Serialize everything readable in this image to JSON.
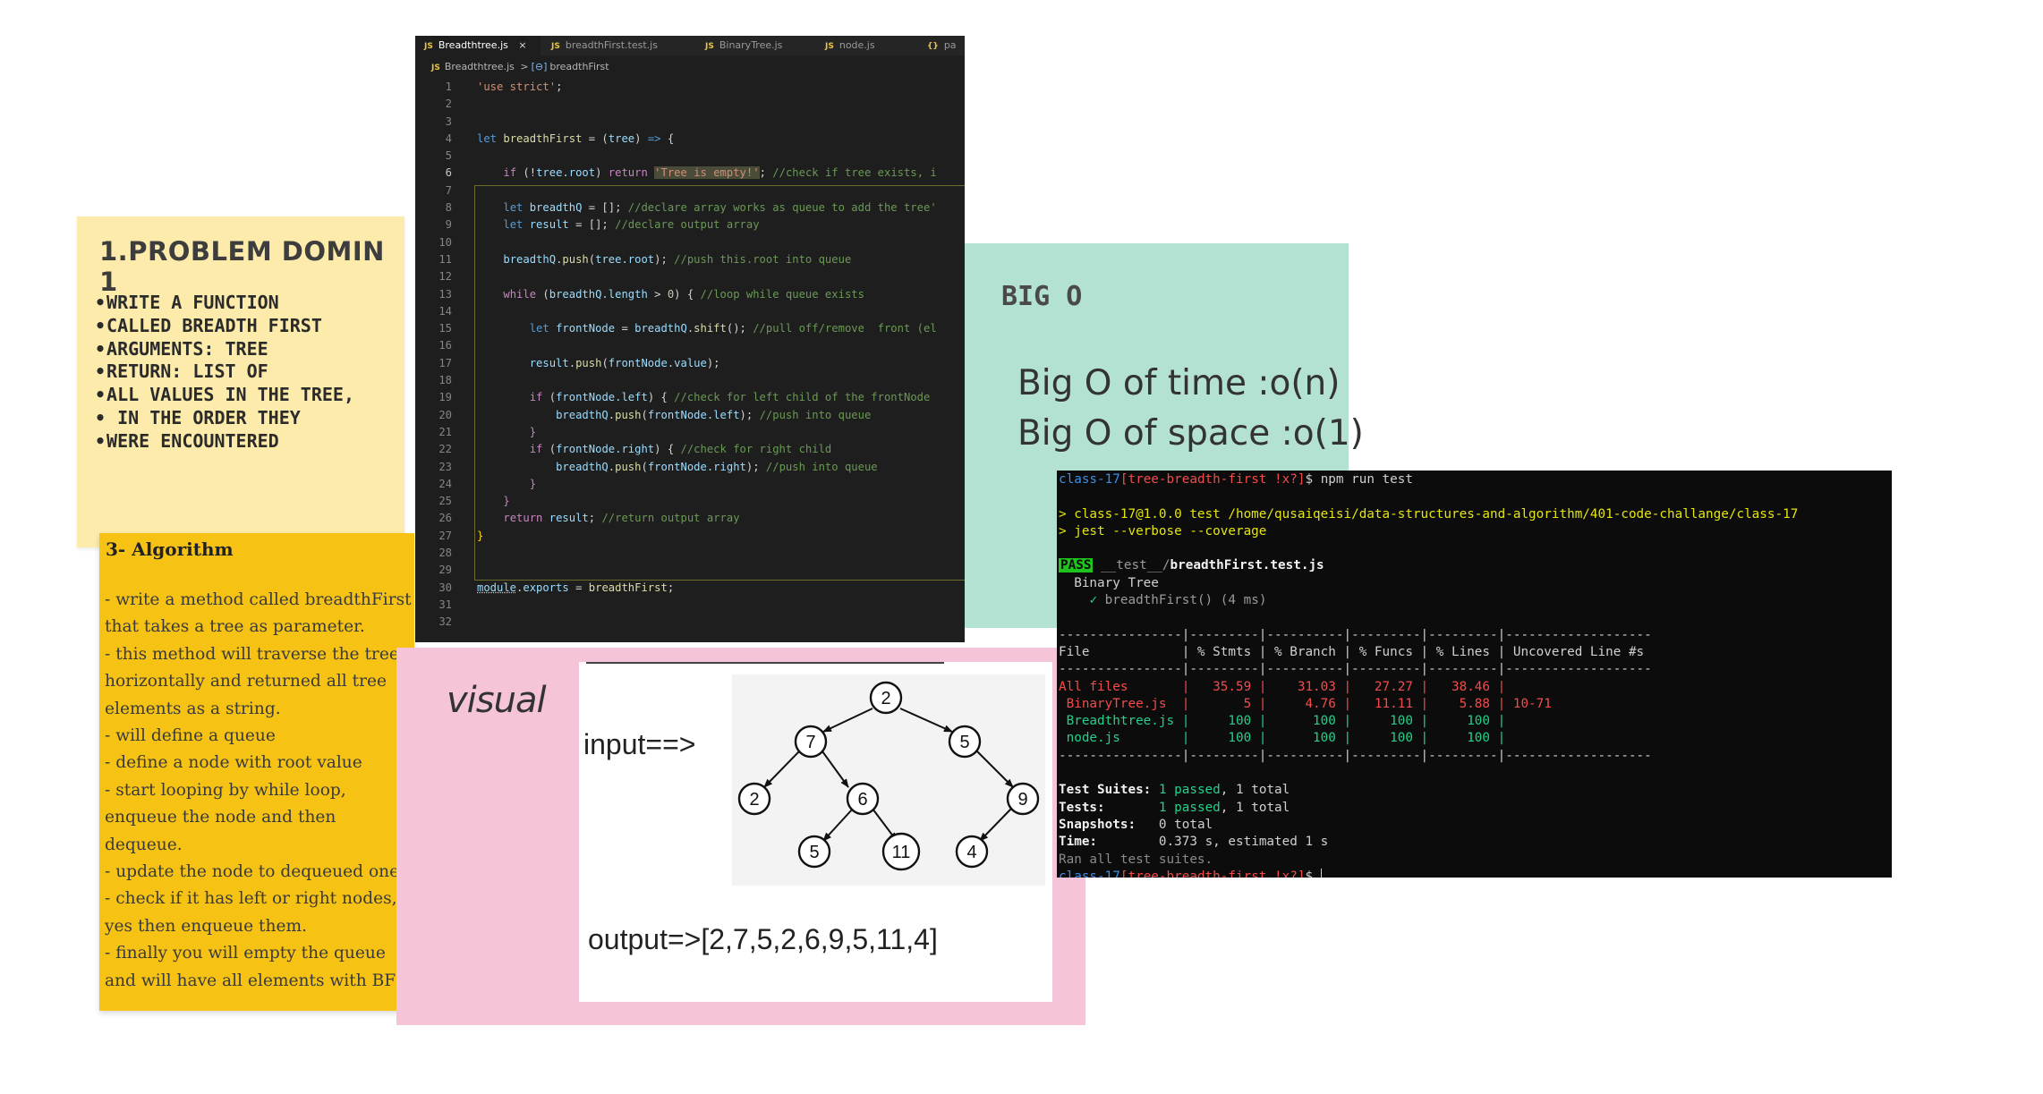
{
  "problem_note": {
    "title": "1.PROBLEM DOMIN 1",
    "bullets": [
      "WRITE A FUNCTION",
      "CALLED BREADTH FIRST",
      "ARGUMENTS: TREE",
      "RETURN: LIST OF",
      "ALL VALUES IN THE TREE,",
      " IN THE ORDER THEY",
      "WERE ENCOUNTERED"
    ]
  },
  "algorithm_note": {
    "title": "3- Algorithm",
    "lines": [
      "- write a method called breadthFirst",
      "that takes a tree as parameter.",
      "- this method will traverse the tree",
      "horizontally and returned all tree",
      "elements as a string.",
      "- will define a queue",
      "- define a node with root value",
      "- start looping by while loop,",
      "enqueue the node and then",
      "dequeue.",
      "- update the node to dequeued one.",
      "- check if it has left or right nodes, if",
      "yes then enqueue them.",
      "- finally you will empty the queue",
      "and will have all elements with BFS."
    ]
  },
  "big_o_note": {
    "title": "BIG O",
    "time": "Big O of time :o(n)",
    "space": "Big O of space :o(1)"
  },
  "visual_note": {
    "title": "visual",
    "input_label": "input==>",
    "output_label": "output=>[2,7,5,2,6,9,5,11,4]",
    "tree_nodes": {
      "root": "2",
      "l": "7",
      "r": "5",
      "ll": "2",
      "lr": "6",
      "rr": "9",
      "lrl": "5",
      "lrr": "11",
      "rrl": "4"
    }
  },
  "editor": {
    "tabs": [
      {
        "label": "Breadthtree.js",
        "icon": "JS",
        "close": "×"
      },
      {
        "label": "breadthFirst.test.js",
        "icon": "JS"
      },
      {
        "label": "BinaryTree.js",
        "icon": "JS"
      },
      {
        "label": "node.js",
        "icon": "JS"
      },
      {
        "label": "pa",
        "icon": "{}"
      }
    ],
    "breadcrumb": {
      "icon": "JS",
      "file": "Breadthtree.js",
      "separator": ">",
      "symbol_icon": "[⊖]",
      "symbol": "breadthFirst"
    },
    "line_numbers": [
      "1",
      "2",
      "3",
      "4",
      "5",
      "6",
      "7",
      "8",
      "9",
      "10",
      "11",
      "12",
      "13",
      "14",
      "15",
      "16",
      "17",
      "18",
      "19",
      "20",
      "21",
      "22",
      "23",
      "24",
      "25",
      "26",
      "27",
      "28",
      "29",
      "30",
      "31",
      "32"
    ],
    "code": {
      "l1_str": "'use strict'",
      "l1_pu": ";",
      "l4_kw": "let",
      "l4_fn": "breadthFirst",
      "l4_pu1": " = (",
      "l4_vr": "tree",
      "l4_pu2": ") ",
      "l4_kw2": "=>",
      "l4_pu3": " {",
      "l6_ctl": "if",
      "l6_pu1": " (!",
      "l6_vr": "tree.root",
      "l6_pu2": ") ",
      "l6_ctl2": "return",
      "l6_str": "'Tree is empty!'",
      "l6_pu3": "; ",
      "l6_cm": "//check if tree exists, i",
      "l8_kw": "let",
      "l8_vr": "breadthQ",
      "l8_pu": " = []; ",
      "l8_cm": "//declare array works as queue to add the tree'",
      "l9_kw": "let",
      "l9_vr": "result",
      "l9_pu": " = []; ",
      "l9_cm": "//declare output array",
      "l11_vr": "breadthQ",
      "l11_pu1": ".",
      "l11_fn": "push",
      "l11_pu2": "(",
      "l11_vr2": "tree.root",
      "l11_pu3": "); ",
      "l11_cm": "//push this.root into queue",
      "l13_ctl": "while",
      "l13_pu1": " (",
      "l13_vr": "breadthQ.length",
      "l13_pu2": " > ",
      "l13_num": "0",
      "l13_pu3": ") { ",
      "l13_cm": "//loop while queue exists",
      "l15_kw": "let",
      "l15_vr": "frontNode",
      "l15_pu1": " = ",
      "l15_vr2": "breadthQ",
      "l15_pu2": ".",
      "l15_fn": "shift",
      "l15_pu3": "(); ",
      "l15_cm": "//pull off/remove  front (el",
      "l17_vr": "result",
      "l17_pu1": ".",
      "l17_fn": "push",
      "l17_pu2": "(",
      "l17_vr2": "frontNode.value",
      "l17_pu3": ");",
      "l19_ctl": "if",
      "l19_pu1": " (",
      "l19_vr": "frontNode.left",
      "l19_pu2": ") { ",
      "l19_cm": "//check for left child of the frontNode",
      "l20_vr": "breadthQ",
      "l20_pu1": ".",
      "l20_fn": "push",
      "l20_pu2": "(",
      "l20_vr2": "frontNode.left",
      "l20_pu3": "); ",
      "l20_cm": "//push into queue",
      "l21_pu": "}",
      "l22_ctl": "if",
      "l22_pu1": " (",
      "l22_vr": "frontNode.right",
      "l22_pu2": ") { ",
      "l22_cm": "//check for right child",
      "l23_vr": "breadthQ",
      "l23_pu1": ".",
      "l23_fn": "push",
      "l23_pu2": "(",
      "l23_vr2": "frontNode.right",
      "l23_pu3": "); ",
      "l23_cm": "//push into queue",
      "l24_pu": "}",
      "l25_pu": "}",
      "l26_ctl": "return",
      "l26_vr": "result",
      "l26_pu": "; ",
      "l26_cm": "//return output array",
      "l27_pu": "}",
      "l30_vr": "module",
      "l30_pu1": ".",
      "l30_vr2": "exports",
      "l30_pu2": " = ",
      "l30_fn": "breadthFirst",
      "l30_pu3": ";"
    }
  },
  "terminal": {
    "prompt_dir": "class-17",
    "prompt_branch": "[tree-breadth-first !x?]",
    "prompt_end": "$ ",
    "command": "npm run test",
    "script_line1": "> class-17@1.0.0 test /home/qusaiqeisi/data-structures-and-algorithm/401-code-challange/class-17",
    "script_line2": "> jest --verbose --coverage",
    "pass_badge": "PASS",
    "test_dir": "__test__/",
    "test_file": "breadthFirst.test.js",
    "suite_name": "Binary Tree",
    "check": "✓",
    "test_name": "breadthFirst()",
    "test_time": "(4 ms)",
    "sep_line": "----------------|---------|----------|---------|---------|-------------------",
    "header_line": "File            | % Stmts | % Branch | % Funcs | % Lines | Uncovered Line #s ",
    "coverage_rows": [
      {
        "file": "All files",
        "stmts": "35.59",
        "branch": "31.03",
        "funcs": "27.27",
        "lines": "38.46",
        "uncovered": ""
      },
      {
        "file": " BinaryTree.js",
        "stmts": "5",
        "branch": "4.76",
        "funcs": "11.11",
        "lines": "5.88",
        "uncovered": "10-71"
      },
      {
        "file": " Breadthtree.js",
        "stmts": "100",
        "branch": "100",
        "funcs": "100",
        "lines": "100",
        "uncovered": ""
      },
      {
        "file": " node.js",
        "stmts": "100",
        "branch": "100",
        "funcs": "100",
        "lines": "100",
        "uncovered": ""
      }
    ],
    "suites_label": "Test Suites:",
    "suites_value": "1 passed",
    "suites_total": ", 1 total",
    "tests_label": "Tests:",
    "tests_value": "1 passed",
    "tests_total": ", 1 total",
    "snapshots_label": "Snapshots:",
    "snapshots_value": "0 total",
    "time_label": "Time:",
    "time_value": "0.373 s, estimated 1 s",
    "ran_all": "Ran all test suites.",
    "colors": {
      "prompt": "#3b8eea",
      "script": "#e5e510",
      "pass": "#23d18b",
      "fail": "#f14c4c"
    }
  }
}
